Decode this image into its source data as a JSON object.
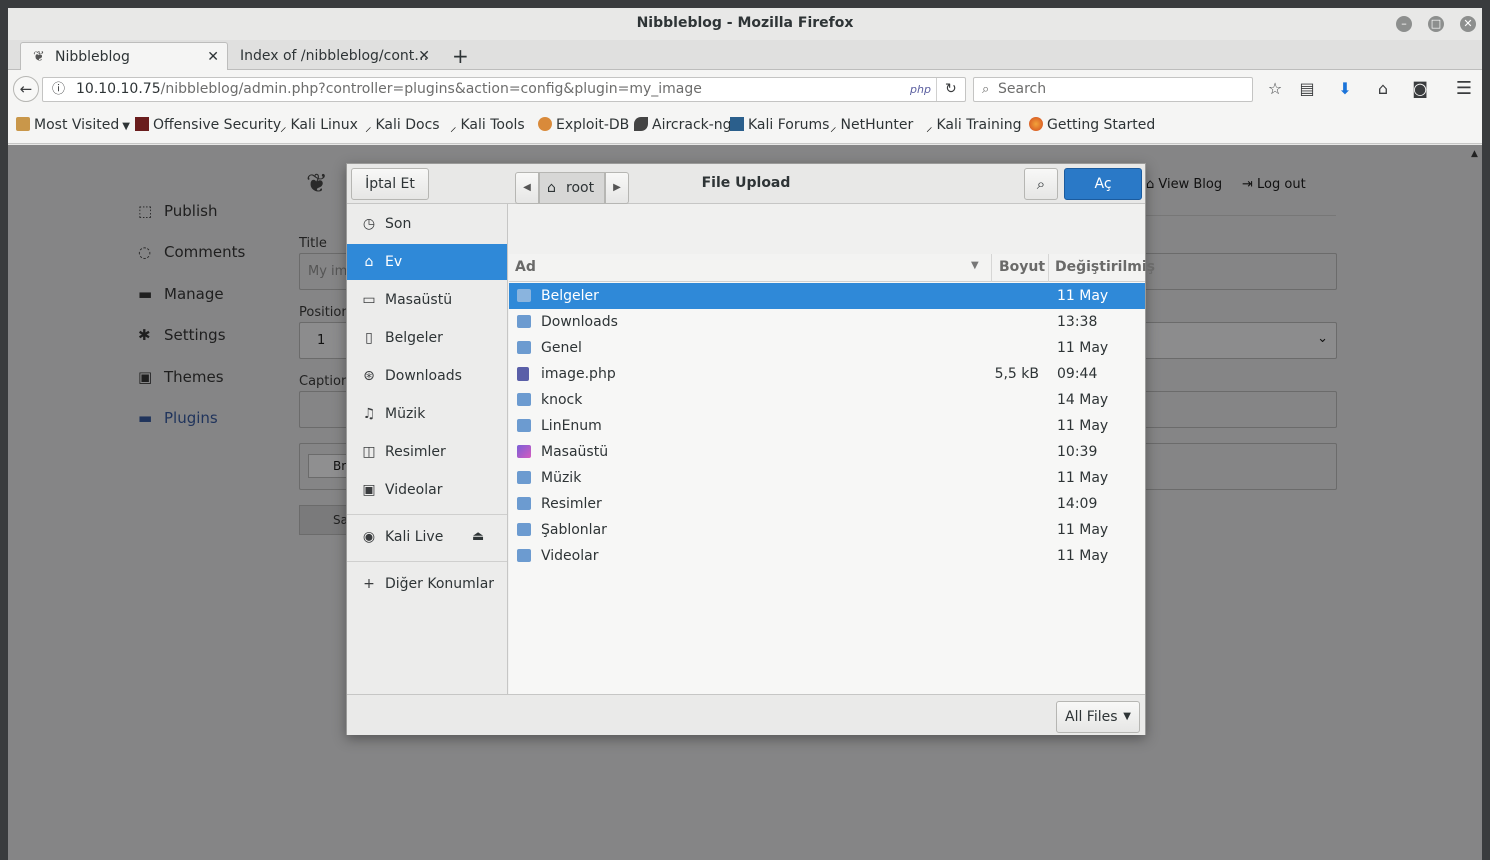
{
  "window": {
    "title": "Nibbleblog - Mozilla Firefox"
  },
  "tabs": [
    {
      "label": "Nibbleblog",
      "active": true
    },
    {
      "label": "Index of /nibbleblog/cont…",
      "active": false
    }
  ],
  "nav": {
    "url_host": "10.10.10.75",
    "url_path": "/nibbleblog/admin.php?controller=plugins&action=config&plugin=my_image",
    "php_badge": "php",
    "search_placeholder": "Search"
  },
  "bookmarks": [
    {
      "label": "Most Visited",
      "icon": "folder-icon"
    },
    {
      "label": "Offensive Security",
      "icon": "offsec-icon"
    },
    {
      "label": "Kali Linux",
      "icon": "kali-icon"
    },
    {
      "label": "Kali Docs",
      "icon": "kali-icon"
    },
    {
      "label": "Kali Tools",
      "icon": "kali-icon"
    },
    {
      "label": "Exploit-DB",
      "icon": "exploitdb-icon"
    },
    {
      "label": "Aircrack-ng",
      "icon": "aircrack-icon"
    },
    {
      "label": "Kali Forums",
      "icon": "kali-forums-icon"
    },
    {
      "label": "NetHunter",
      "icon": "kali-icon"
    },
    {
      "label": "Kali Training",
      "icon": "kali-icon"
    },
    {
      "label": "Getting Started",
      "icon": "firefox-icon"
    }
  ],
  "sidebar": {
    "items": [
      {
        "label": "Publish",
        "icon": "publish-icon"
      },
      {
        "label": "Comments",
        "icon": "comments-icon"
      },
      {
        "label": "Manage",
        "icon": "folder-icon"
      },
      {
        "label": "Settings",
        "icon": "gear-icon"
      },
      {
        "label": "Themes",
        "icon": "image-icon"
      },
      {
        "label": "Plugins",
        "icon": "folder-icon"
      }
    ]
  },
  "form": {
    "title_label": "Title",
    "title_placeholder": "My im",
    "position_label": "Position",
    "position_value": "1",
    "caption_label": "Caption",
    "browse_label": "Br",
    "save_label": "Sa"
  },
  "top_links": {
    "view_blog": "View Blog",
    "logout": "Log out"
  },
  "dialog": {
    "title": "File Upload",
    "cancel_label": "İptal Et",
    "open_label": "Aç",
    "path_root": "root",
    "places": [
      {
        "label": "Son",
        "icon": "clock-icon"
      },
      {
        "label": "Ev",
        "icon": "home-icon",
        "selected": true
      },
      {
        "label": "Masaüstü",
        "icon": "desktop-icon"
      },
      {
        "label": "Belgeler",
        "icon": "document-icon"
      },
      {
        "label": "Downloads",
        "icon": "download-icon"
      },
      {
        "label": "Müzik",
        "icon": "music-icon"
      },
      {
        "label": "Resimler",
        "icon": "camera-icon"
      },
      {
        "label": "Videolar",
        "icon": "film-icon"
      },
      {
        "label": "Kali Live",
        "icon": "disc-icon"
      },
      {
        "label": "Diğer Konumlar",
        "icon": "plus-icon"
      }
    ],
    "columns": {
      "name": "Ad",
      "size": "Boyut",
      "modified": "Değiştirilmiş"
    },
    "files": [
      {
        "name": "Belgeler",
        "size": "",
        "modified": "11 May",
        "icon": "folder-documents-icon",
        "selected": true
      },
      {
        "name": "Downloads",
        "size": "",
        "modified": "13:38",
        "icon": "folder-download-icon"
      },
      {
        "name": "Genel",
        "size": "",
        "modified": "11 May",
        "icon": "folder-public-icon"
      },
      {
        "name": "image.php",
        "size": "5,5 kB",
        "modified": "09:44",
        "icon": "php-file-icon"
      },
      {
        "name": "knock",
        "size": "",
        "modified": "14 May",
        "icon": "folder-icon"
      },
      {
        "name": "LinEnum",
        "size": "",
        "modified": "11 May",
        "icon": "folder-icon"
      },
      {
        "name": "Masaüstü",
        "size": "",
        "modified": "10:39",
        "icon": "folder-desktop-icon"
      },
      {
        "name": "Müzik",
        "size": "",
        "modified": "11 May",
        "icon": "folder-music-icon"
      },
      {
        "name": "Resimler",
        "size": "",
        "modified": "14:09",
        "icon": "folder-pictures-icon"
      },
      {
        "name": "Şablonlar",
        "size": "",
        "modified": "11 May",
        "icon": "folder-templates-icon"
      },
      {
        "name": "Videolar",
        "size": "",
        "modified": "11 May",
        "icon": "folder-videos-icon"
      }
    ],
    "filter_label": "All Files"
  }
}
